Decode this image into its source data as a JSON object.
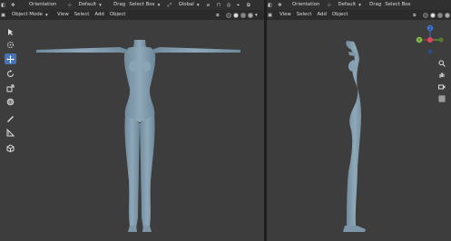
{
  "left_view": {
    "header": {
      "orientation_label": "Orientation",
      "orientation_value": "Default",
      "drag_label": "Drag",
      "select_mode": "Select Box",
      "transform_space": "Global"
    },
    "subheader": {
      "mode": "Object Mode",
      "menus": [
        "View",
        "Select",
        "Add",
        "Object"
      ]
    }
  },
  "right_view": {
    "header": {
      "orientation_label": "Orientation",
      "orientation_value": "Default",
      "drag_label": "Drag",
      "select_mode": "Select Box"
    },
    "subheader": {
      "menus": [
        "View",
        "Select",
        "Add",
        "Object"
      ]
    },
    "gizmo": {
      "z": "Z",
      "y": "Y"
    }
  },
  "colors": {
    "viewport": "#3d3d3d",
    "header": "#303030",
    "active_tool": "#4772b3",
    "mesh": "#7f9bad"
  }
}
